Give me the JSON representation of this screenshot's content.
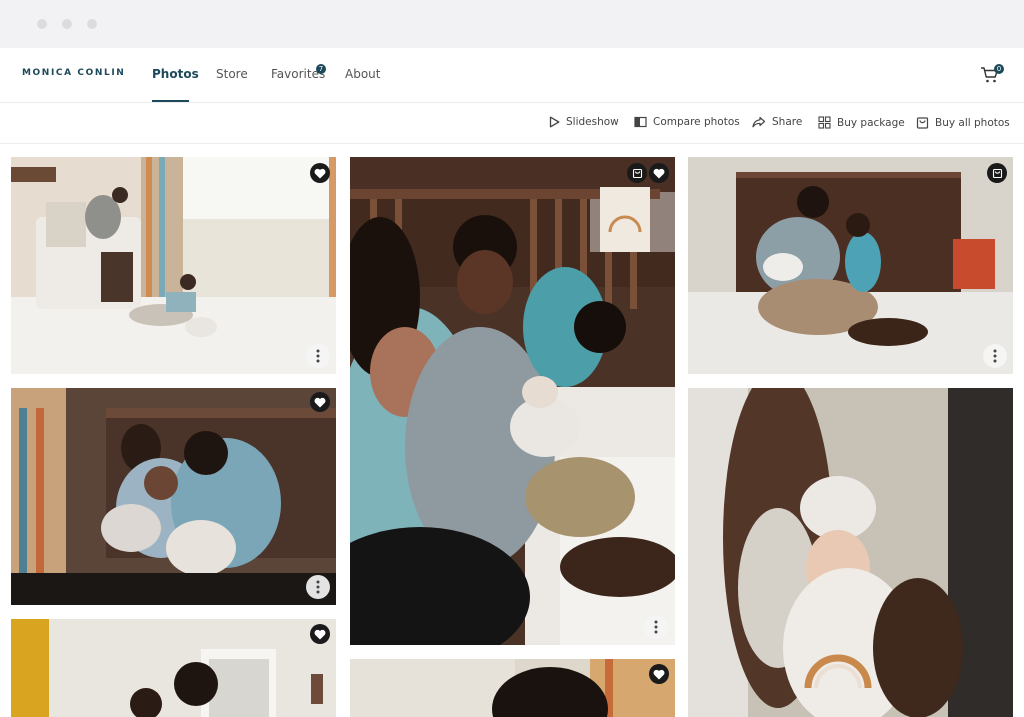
{
  "brand": "MONICA CONLIN",
  "nav": {
    "photos": "Photos",
    "store": "Store",
    "favorites": "Favorites",
    "favorites_count": "7",
    "about": "About",
    "cart_count": "0"
  },
  "toolbar": {
    "slideshow": "Slideshow",
    "compare": "Compare photos",
    "share": "Share",
    "buy_package": "Buy package",
    "buy_all": "Buy all photos"
  },
  "colors": {
    "accent": "#1d4a5a",
    "chrome": "#f2f2f4"
  },
  "photos": [
    {
      "name": "nursery-father-son",
      "col": 1,
      "favorite": true,
      "in_cart": false
    },
    {
      "name": "family-crib-newborn",
      "col": 2,
      "favorite": true,
      "in_cart": true
    },
    {
      "name": "father-sons-dresser",
      "col": 3,
      "favorite": false,
      "in_cart": true
    },
    {
      "name": "family-embrace-bed",
      "col": 1,
      "favorite": true,
      "in_cart": false
    },
    {
      "name": "newborn-close-up",
      "col": 3,
      "favorite": false,
      "in_cart": false
    },
    {
      "name": "family-window",
      "col": 1,
      "favorite": true,
      "in_cart": false
    },
    {
      "name": "child-head-window",
      "col": 2,
      "favorite": true,
      "in_cart": false
    }
  ]
}
